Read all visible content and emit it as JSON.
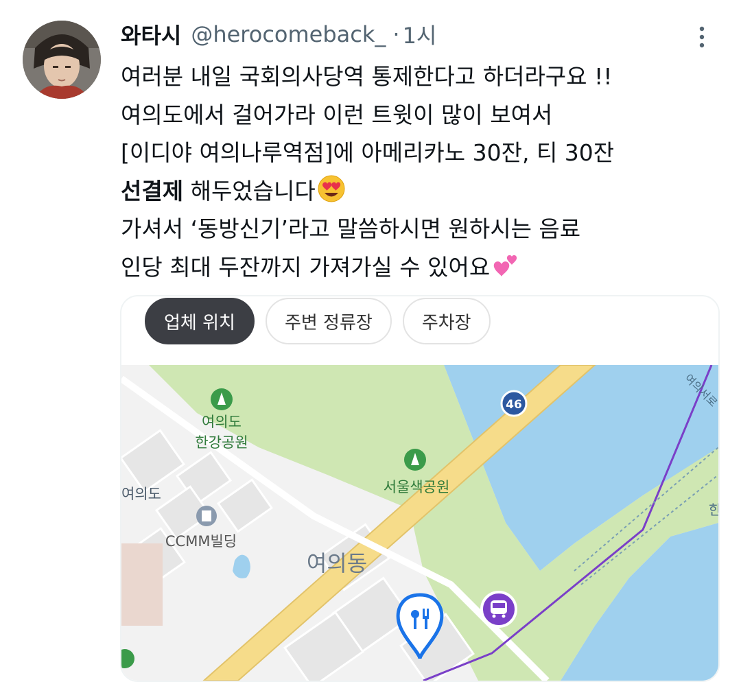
{
  "tweet": {
    "display_name": "와타시",
    "handle": "@herocomeback_",
    "separator": "·",
    "time": "1시",
    "more_icon": "more-vertical-icon",
    "lines": {
      "l1": "여러분 내일 국회의사당역 통제한다고 하더라구요 !!",
      "l2": "여의도에서 걸어가라 이런 트윗이 많이 보여서",
      "l3": "[이디야 여의나루역점]에 아메리카노 30잔, 티 30잔",
      "l4_bold": "선결제",
      "l4_rest": " 해두었습니다",
      "l5": "가셔서 ‘동방신기’라고 말씀하시면 원하시는 음료",
      "l6": "인당 최대 두잔까지 가져가실 수 있어요"
    },
    "emojis": [
      "heart-eyes-emoji",
      "two-hearts-emoji"
    ]
  },
  "card": {
    "tabs": {
      "t1": "업체 위치",
      "t2": "주변 정류장",
      "t3": "주차장"
    },
    "map": {
      "park1_l1": "여의도",
      "park1_l2": "한강공원",
      "park2": "서울색공원",
      "left_label": "여의도",
      "building": "CCMM빌딩",
      "district": "여의동",
      "route_number": "46",
      "river_label_top": "여의서로",
      "edge_label": "한",
      "colors": {
        "water": "#9fd0ee",
        "park": "#cfe7b3",
        "road": "#f6dc8a",
        "land": "#f2f2f2",
        "subway_line": "#7a3fc8",
        "marker": "#1a73e8"
      }
    }
  }
}
